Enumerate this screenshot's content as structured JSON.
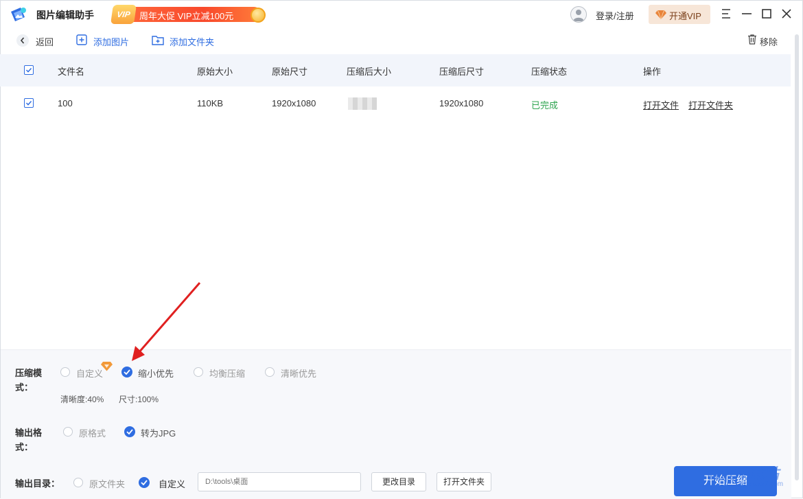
{
  "app": {
    "title": "图片编辑助手"
  },
  "promo": {
    "badge": "VIP",
    "text": "周年大促 VIP立减100元"
  },
  "header": {
    "login_label": "登录/注册",
    "vip_label": "开通VIP"
  },
  "toolbar": {
    "back_label": "返回",
    "add_image_label": "添加图片",
    "add_folder_label": "添加文件夹",
    "remove_label": "移除"
  },
  "table": {
    "headers": [
      "文件名",
      "原始大小",
      "原始尺寸",
      "压缩后大小",
      "压缩后尺寸",
      "压缩状态",
      "操作"
    ],
    "rows": [
      {
        "name": "100",
        "orig_size": "110KB",
        "orig_dims": "1920x1080",
        "new_dims": "1920x1080",
        "status": "已完成",
        "action_open_file": "打开文件",
        "action_open_folder": "打开文件夹"
      }
    ]
  },
  "settings": {
    "mode_label_1": "压缩模",
    "mode_label_2": "式：",
    "modes": [
      "自定义",
      "缩小优先",
      "均衡压缩",
      "清晰优先"
    ],
    "selected_mode": "缩小优先",
    "clarity": "清晰度:40%",
    "size": "尺寸:100%",
    "format_label_1": "输出格",
    "format_label_2": "式：",
    "formats": [
      "原格式",
      "转为JPG"
    ],
    "selected_format": "转为JPG",
    "dir_label": "输出目录：",
    "dirs": [
      "原文件夹",
      "自定义"
    ],
    "selected_dir": "自定义",
    "dir_placeholder": "D:\\tools\\桌面",
    "change_dir_label": "更改目录",
    "open_folder_label": "打开文件夹",
    "start_label": "开始压缩"
  },
  "watermark": {
    "main": "极光下载站",
    "sub": "www.xz7.com"
  },
  "colors": {
    "accent": "#2f6de1",
    "success": "#2ea44f",
    "promo": "#f8492c",
    "annotation": "#e02020"
  }
}
